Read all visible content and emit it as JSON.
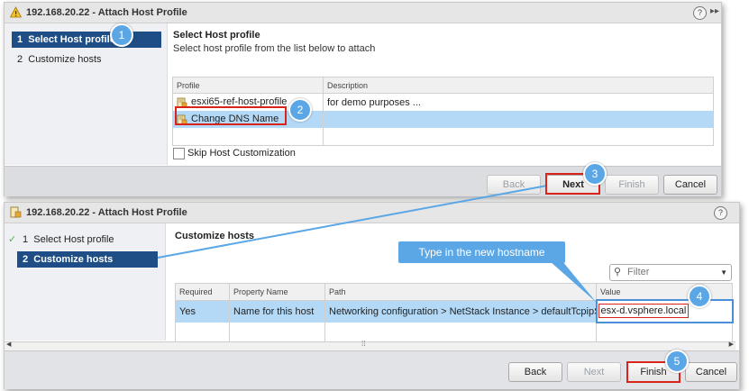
{
  "dialog1": {
    "title": "192.168.20.22 - Attach Host Profile",
    "steps": [
      {
        "num": "1",
        "label": "Select Host profile"
      },
      {
        "num": "2",
        "label": "Customize hosts"
      }
    ],
    "section_title": "Select Host profile",
    "section_desc": "Select host profile from the list below to attach",
    "columns": [
      "Profile",
      "Description"
    ],
    "rows": [
      {
        "profile": "esxi65-ref-host-profile",
        "description": "for demo purposes ..."
      },
      {
        "profile": "Change DNS Name",
        "description": ""
      }
    ],
    "skip_label": "Skip Host Customization",
    "buttons": {
      "back": "Back",
      "next": "Next",
      "finish": "Finish",
      "cancel": "Cancel"
    }
  },
  "dialog2": {
    "title": "192.168.20.22 - Attach Host Profile",
    "steps": [
      {
        "num": "1",
        "label": "Select Host profile"
      },
      {
        "num": "2",
        "label": "Customize hosts"
      }
    ],
    "section_title": "Customize hosts",
    "filter_placeholder": "Filter",
    "columns": [
      "Required",
      "Property Name",
      "Path",
      "Value"
    ],
    "row": {
      "required": "Yes",
      "property": "Name for this host",
      "path": "Networking configuration > NetStack Instance > defaultTcpipSt...",
      "value": "esx-d.vsphere.local"
    },
    "buttons": {
      "back": "Back",
      "next": "Next",
      "finish": "Finish",
      "cancel": "Cancel"
    }
  },
  "callouts": [
    "1",
    "2",
    "3",
    "4",
    "5"
  ],
  "banner": "Type in the new hostname",
  "colors": {
    "accent": "#5ba7e6",
    "selected_step": "#1f4e86",
    "selection_row": "#b3d9f7",
    "highlight_box": "#d9241c"
  }
}
